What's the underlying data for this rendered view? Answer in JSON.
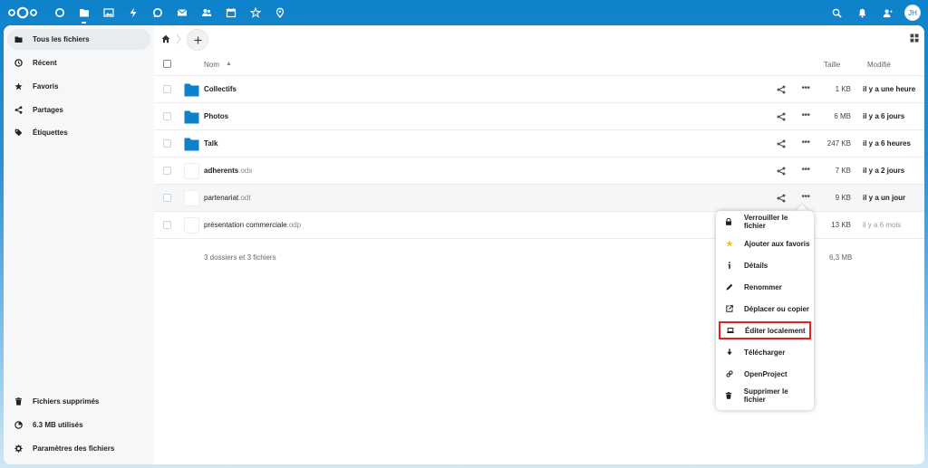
{
  "topbar": {
    "apps": [
      "dashboard-icon",
      "files-icon",
      "photos-icon",
      "activity-icon",
      "talk-icon",
      "mail-icon",
      "contacts-icon",
      "calendar-icon",
      "openproject-icon",
      "maps-icon"
    ],
    "avatar_initials": "JH"
  },
  "sidebar": {
    "items": [
      {
        "label": "Tous les fichiers",
        "icon": "folder-icon"
      },
      {
        "label": "Récent",
        "icon": "clock-icon"
      },
      {
        "label": "Favoris",
        "icon": "star-icon"
      },
      {
        "label": "Partages",
        "icon": "share-icon"
      },
      {
        "label": "Étiquettes",
        "icon": "tag-icon"
      }
    ],
    "footer": [
      {
        "label": "Fichiers supprimés",
        "icon": "trash-icon"
      },
      {
        "label": "6.3 MB utilisés",
        "icon": "pie-chart-icon"
      },
      {
        "label": "Paramètres des fichiers",
        "icon": "gear-icon"
      }
    ]
  },
  "table": {
    "header": {
      "name": "Nom",
      "sort": "▲",
      "size": "Taille",
      "modified": "Modifié"
    },
    "rows": [
      {
        "name": "Collectifs",
        "ext": "",
        "type": "folder",
        "size": "1 KB",
        "modified": "il y a une heure",
        "dim": false
      },
      {
        "name": "Photos",
        "ext": "",
        "type": "folder",
        "size": "6 MB",
        "modified": "il y a 6 jours",
        "dim": false
      },
      {
        "name": "Talk",
        "ext": "",
        "type": "folder",
        "size": "247 KB",
        "modified": "il y a 6 heures",
        "dim": false
      },
      {
        "name": "adherents",
        "ext": ".ods",
        "type": "file",
        "size": "7 KB",
        "modified": "il y a 2 jours",
        "dim": false
      },
      {
        "name": "partenariat",
        "ext": ".odt",
        "type": "file",
        "size": "9 KB",
        "modified": "il y a un jour",
        "dim": false
      },
      {
        "name": "présentation commerciale",
        "ext": ".odp",
        "type": "file",
        "size": "13 KB",
        "modified": "il y a 6 mois",
        "dim": true
      }
    ],
    "summary": "3 dossiers et 3 fichiers",
    "summary_size": "6,3 MB"
  },
  "context_menu": {
    "items": [
      {
        "label": "Verrouiller le fichier",
        "icon": "lock-icon"
      },
      {
        "label": "Ajouter aux favoris",
        "icon": "star-icon"
      },
      {
        "label": "Détails",
        "icon": "info-icon"
      },
      {
        "label": "Renommer",
        "icon": "pencil-icon"
      },
      {
        "label": "Déplacer ou copier",
        "icon": "move-icon"
      },
      {
        "label": "Éditer localement",
        "icon": "laptop-icon"
      },
      {
        "label": "Télécharger",
        "icon": "download-icon"
      },
      {
        "label": "OpenProject",
        "icon": "link-icon"
      },
      {
        "label": "Supprimer le fichier",
        "icon": "trash-icon"
      }
    ],
    "highlighted_index": 5
  },
  "colors": {
    "brand": "#0d82ca",
    "folder": "#0d82ca",
    "highlight_border": "#e3211f",
    "star": "#f2c230"
  }
}
